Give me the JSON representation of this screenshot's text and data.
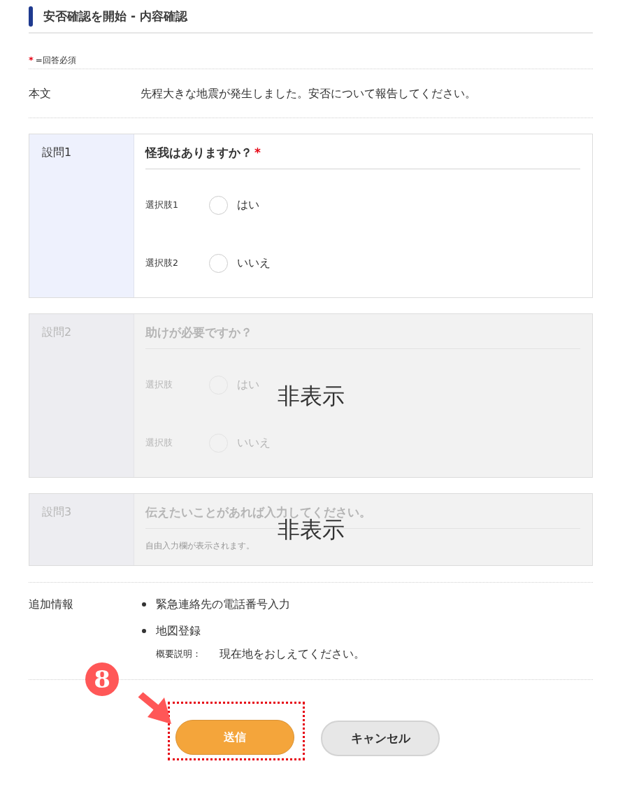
{
  "page_title": "安否確認を開始 - 内容確認",
  "required_legend": {
    "mark": "*",
    "text": "=回答必須"
  },
  "body": {
    "label": "本文",
    "text": "先程大きな地震が発生しました。安否について報告してください。"
  },
  "questions": [
    {
      "number": "設問1",
      "kind": "choice",
      "title": "怪我はありますか？",
      "required_mark": "*",
      "hidden": false,
      "options": [
        {
          "label": "選択肢1",
          "text": "はい",
          "checked": false
        },
        {
          "label": "選択肢2",
          "text": "いいえ",
          "checked": false
        }
      ]
    },
    {
      "number": "設問2",
      "kind": "choice",
      "title": "助けが必要ですか？",
      "hidden": true,
      "hidden_label": "非表示",
      "options": [
        {
          "label": "選択肢",
          "text": "はい",
          "checked": false
        },
        {
          "label": "選択肢",
          "text": "いいえ",
          "checked": false
        }
      ]
    },
    {
      "number": "設問3",
      "kind": "free_text",
      "title": "伝えたいことがあれば入力してください。",
      "hidden": true,
      "hidden_label": "非表示",
      "note": "自由入力欄が表示されます。"
    }
  ],
  "additional_info": {
    "label": "追加情報",
    "items": [
      {
        "text": "緊急連絡先の電話番号入力"
      },
      {
        "text": "地図登録",
        "detail_label": "概要説明：",
        "detail_value": "現在地をおしえてください。"
      }
    ]
  },
  "step_marker": "8",
  "buttons": [
    {
      "label": "送信",
      "kind": "primary",
      "highlighted": true
    },
    {
      "label": "キャンセル",
      "kind": "secondary",
      "highlighted": false
    }
  ]
}
